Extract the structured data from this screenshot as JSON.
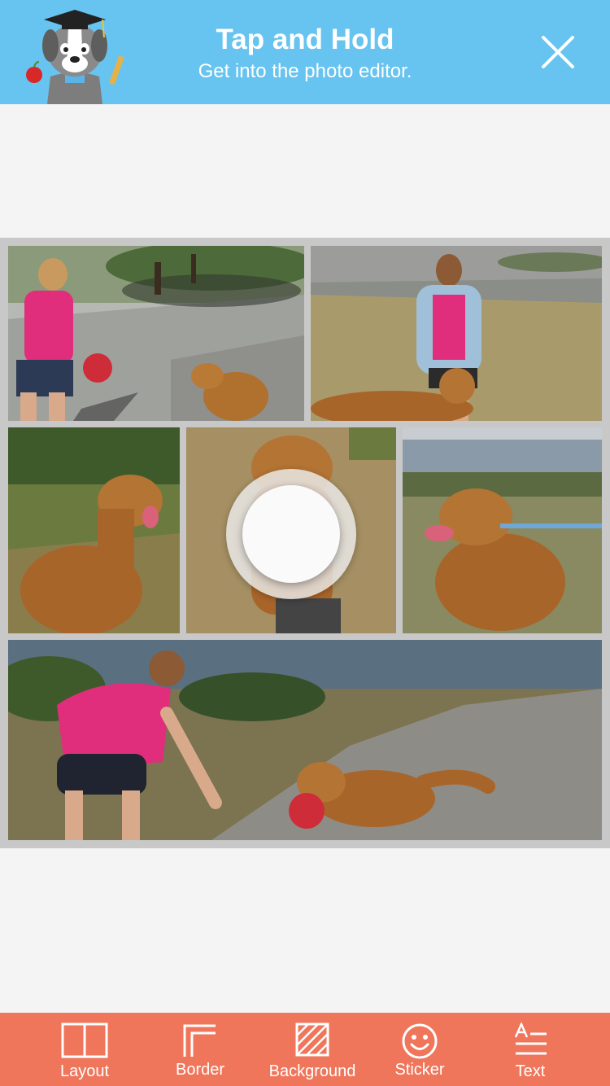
{
  "banner": {
    "title": "Tap and Hold",
    "subtitle": "Get into the photo editor.",
    "mascot_icon": "dog-graduate-mascot-icon",
    "close_icon": "close-icon",
    "background_color": "#67c3ef"
  },
  "collage": {
    "photos": [
      {
        "description": "woman-with-dog-and-ball-on-path"
      },
      {
        "description": "woman-in-denim-shirt-with-dog"
      },
      {
        "description": "golden-retriever-sitting-in-grass"
      },
      {
        "description": "golden-retriever-facing-camera"
      },
      {
        "description": "golden-retriever-with-leash-by-water"
      },
      {
        "description": "woman-playing-with-dog-and-ball"
      }
    ],
    "hint_icon": "tap-and-hold-indicator"
  },
  "toolbar": {
    "background_color": "#f0765b",
    "items": [
      {
        "label": "Layout",
        "icon": "layout-icon"
      },
      {
        "label": "Border",
        "icon": "border-icon"
      },
      {
        "label": "Background",
        "icon": "background-icon"
      },
      {
        "label": "Sticker",
        "icon": "smiley-icon"
      },
      {
        "label": "Text",
        "icon": "text-icon"
      }
    ]
  }
}
